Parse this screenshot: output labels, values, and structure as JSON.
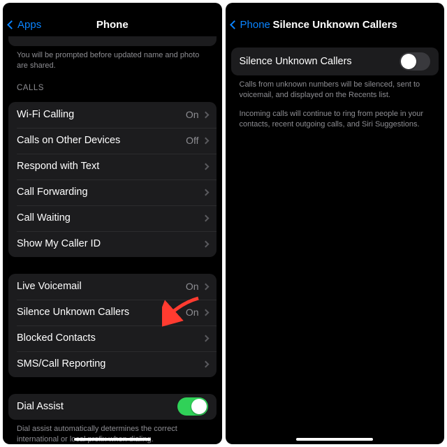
{
  "left": {
    "back_label": "Apps",
    "title": "Phone",
    "intro_footer": "You will be prompted before updated name and photo are shared.",
    "calls_header": "CALLS",
    "rows_calls": [
      {
        "label": "Wi-Fi Calling",
        "value": "On"
      },
      {
        "label": "Calls on Other Devices",
        "value": "Off"
      },
      {
        "label": "Respond with Text",
        "value": ""
      },
      {
        "label": "Call Forwarding",
        "value": ""
      },
      {
        "label": "Call Waiting",
        "value": ""
      },
      {
        "label": "Show My Caller ID",
        "value": ""
      }
    ],
    "rows_voicemail": [
      {
        "label": "Live Voicemail",
        "value": "On"
      },
      {
        "label": "Silence Unknown Callers",
        "value": "On"
      },
      {
        "label": "Blocked Contacts",
        "value": ""
      },
      {
        "label": "SMS/Call Reporting",
        "value": ""
      }
    ],
    "dial_assist_label": "Dial Assist",
    "dial_assist_on": true,
    "dial_assist_footer": "Dial assist automatically determines the correct international or local prefix when dialing."
  },
  "right": {
    "back_label": "Phone",
    "title": "Silence Unknown Callers",
    "toggle_label": "Silence Unknown Callers",
    "toggle_on": false,
    "footer1": "Calls from unknown numbers will be silenced, sent to voicemail, and displayed on the Recents list.",
    "footer2": "Incoming calls will continue to ring from people in your contacts, recent outgoing calls, and Siri Suggestions."
  },
  "colors": {
    "accent": "#0a84ff",
    "switch_on": "#30d158"
  }
}
